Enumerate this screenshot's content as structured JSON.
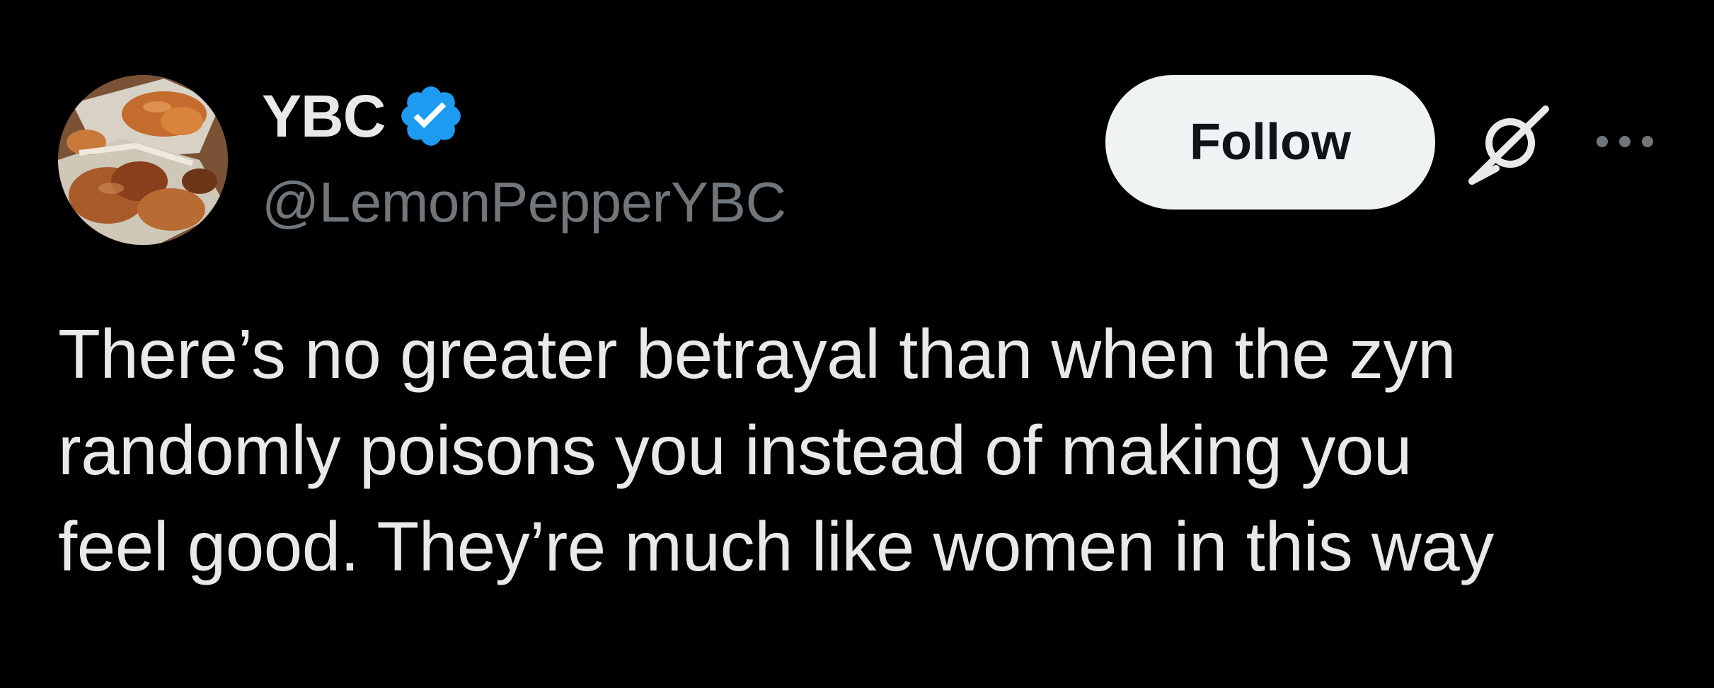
{
  "author": {
    "display_name": "YBC",
    "handle": "@LemonPepperYBC",
    "verified": true,
    "avatar_icon": "food-avatar"
  },
  "actions": {
    "follow_label": "Follow",
    "grok_icon": "grok-icon",
    "more_icon": "more-dots-icon"
  },
  "tweet": {
    "lines": [
      "There’s no greater betrayal than when the zyn",
      "randomly poisons you instead of making you",
      "feel good. They’re much like women in this way"
    ]
  },
  "colors": {
    "background": "#000000",
    "text_primary": "#e7e9ea",
    "text_secondary": "#71767b",
    "verified_blue": "#1d9bf0",
    "follow_bg": "#eff3f4",
    "follow_text": "#0f1419"
  }
}
